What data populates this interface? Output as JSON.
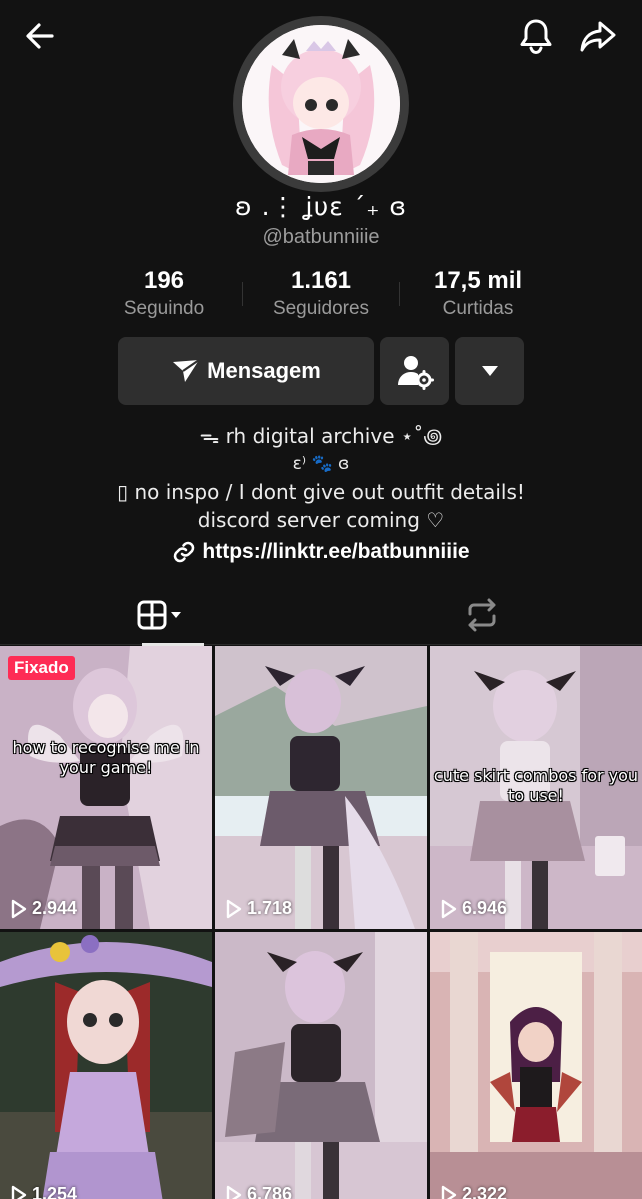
{
  "profile": {
    "display_name": "ʚ .⋮ ʝυε ˊ₊ ɞ",
    "username": "@batbunniiie"
  },
  "stats": [
    {
      "value": "196",
      "label": "Seguindo"
    },
    {
      "value": "1.161",
      "label": "Seguidores"
    },
    {
      "value": "17,5 mil",
      "label": "Curtidas"
    }
  ],
  "actions": {
    "message_label": "Mensagem"
  },
  "bio": {
    "line1": "ᯓ rh digital archive ⋆˚꩜",
    "line2": "ɛ⁾ 🐾 ɞ",
    "line3": "▯ no inspo / I dont give out outfit details!",
    "line4": "discord server coming ♡",
    "link": "https://linktr.ee/batbunniiie"
  },
  "videos": [
    {
      "views": "2.944",
      "pinned_label": "Fixado",
      "caption": "how to recognise me in your game!"
    },
    {
      "views": "1.718"
    },
    {
      "views": "6.946",
      "caption": "cute skirt combos for you to use!"
    },
    {
      "views": "1.254"
    },
    {
      "views": "6.786"
    },
    {
      "views": "2.322"
    }
  ],
  "colors": {
    "background": "#121212",
    "button": "#2f2f2f",
    "pinned_badge": "#fe2c55",
    "secondary_text": "#9a9a9a"
  }
}
